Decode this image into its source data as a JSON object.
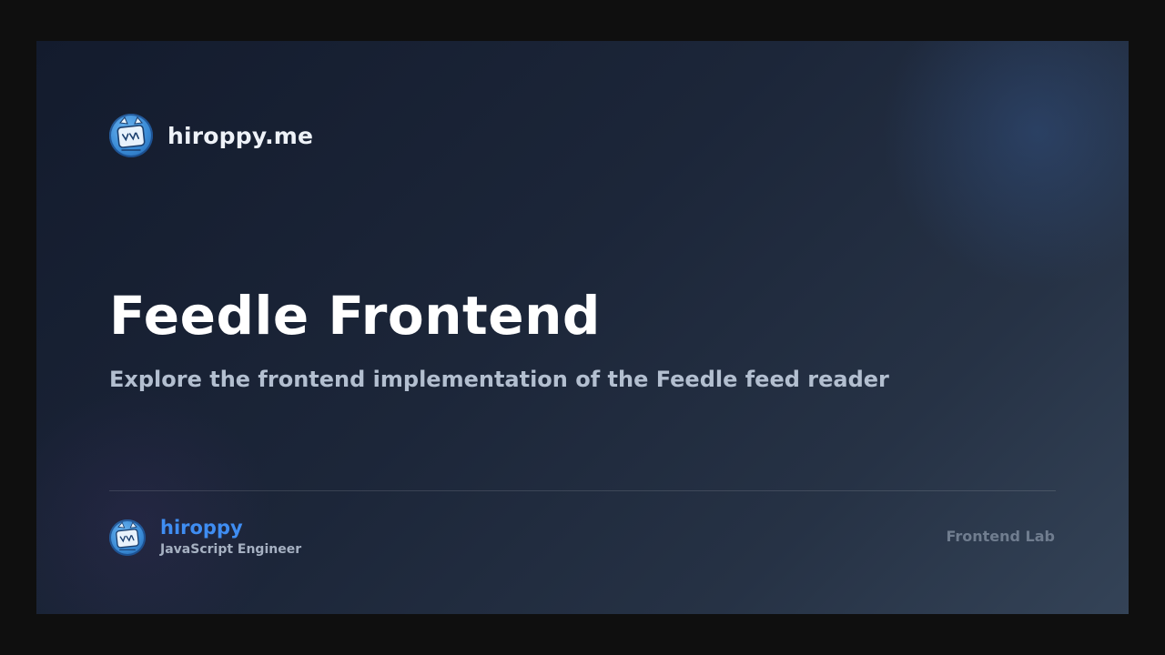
{
  "brand": {
    "site_name": "hiroppy.me",
    "avatar_icon": "hiroppy-avatar-icon"
  },
  "hero": {
    "title": "Feedle Frontend",
    "subtitle": "Explore the frontend implementation of the Feedle feed reader"
  },
  "footer": {
    "author_name": "hiroppy",
    "author_role": "JavaScript Engineer",
    "label": "Frontend Lab"
  },
  "colors": {
    "accent": "#3f8df2",
    "background_start": "#131b2d",
    "background_end": "#344357",
    "title": "#ffffff",
    "subtitle": "#b3bfd0",
    "muted": "#707d8f"
  }
}
